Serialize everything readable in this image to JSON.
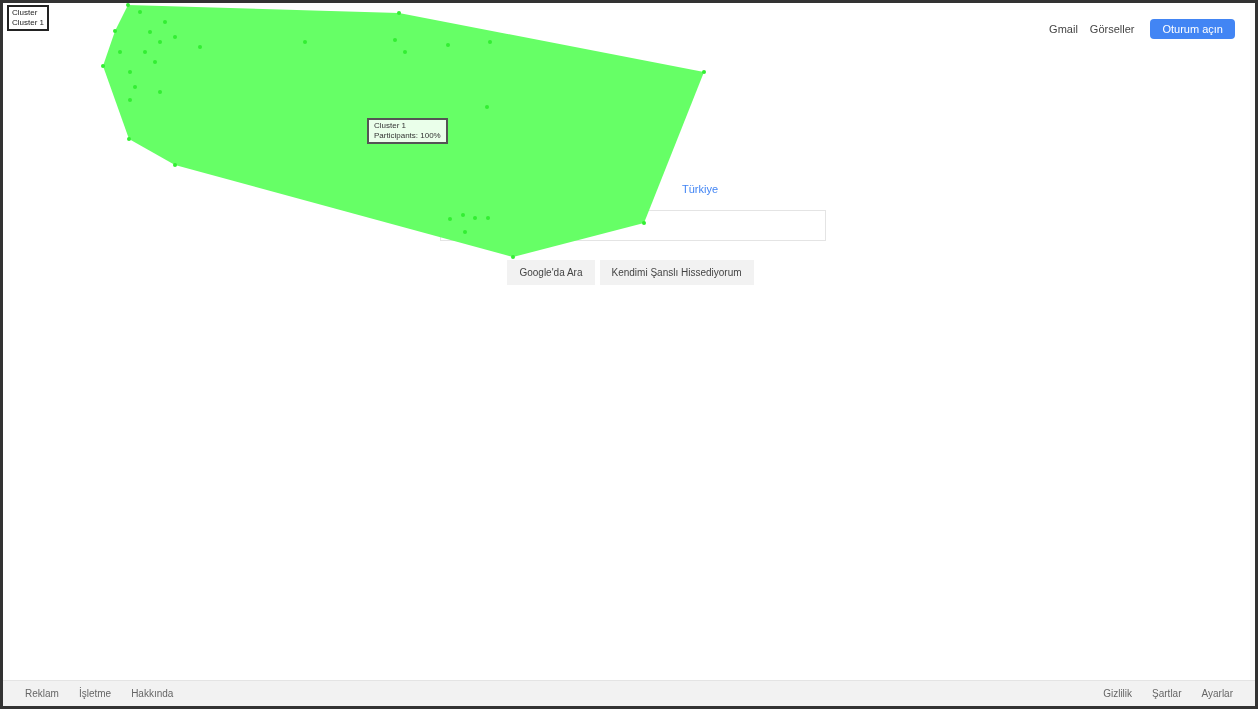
{
  "legend": {
    "title": "Cluster",
    "item": "Cluster 1"
  },
  "top_links": [
    "Gmail",
    "Görseller"
  ],
  "sign_in": "Oturum açın",
  "region": "Türkiye",
  "buttons": [
    "Google'da Ara",
    "Kendimi Şanslı Hissediyorum"
  ],
  "tooltip": {
    "title": "Cluster 1",
    "text": "Participants: 100%"
  },
  "footer_left": [
    "Reklam",
    "İşletme",
    "Hakkında"
  ],
  "footer_right": [
    "Gizlilik",
    "Şartlar",
    "Ayarlar"
  ]
}
